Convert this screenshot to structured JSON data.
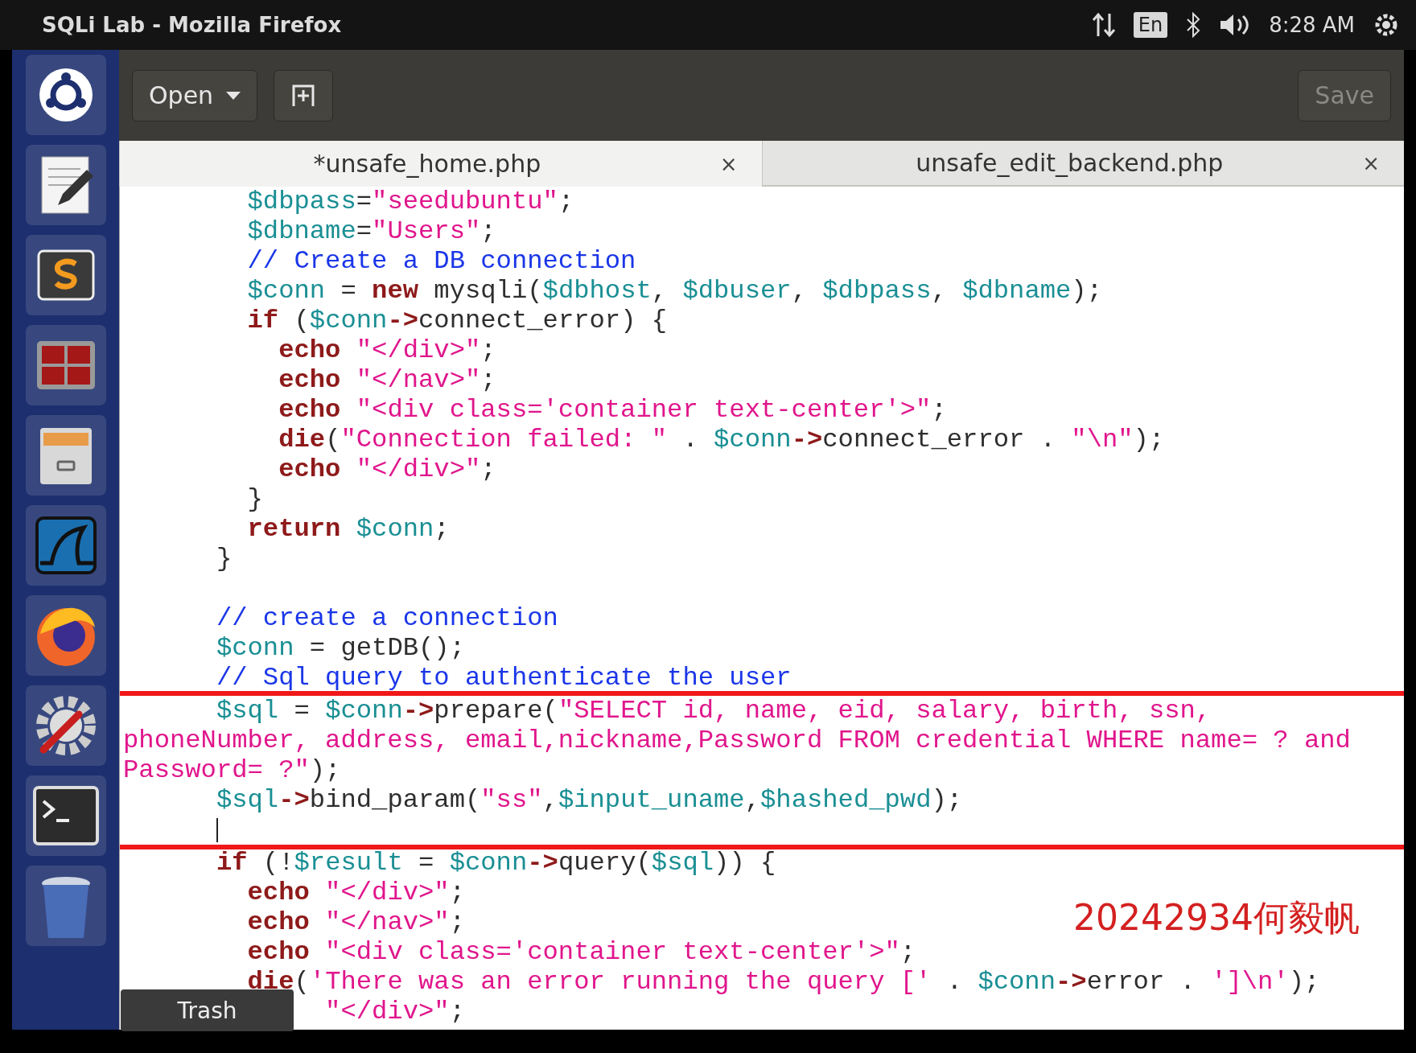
{
  "window": {
    "title": "SQLi Lab - Mozilla Firefox"
  },
  "panel": {
    "keyboard": "En",
    "clock": "8:28 AM"
  },
  "launcher": {
    "items": [
      {
        "kind": "ubuntu"
      },
      {
        "kind": "editor"
      },
      {
        "kind": "sublime"
      },
      {
        "kind": "terminals"
      },
      {
        "kind": "files"
      },
      {
        "kind": "wireshark"
      },
      {
        "kind": "firefox"
      },
      {
        "kind": "settings"
      },
      {
        "kind": "terminal"
      },
      {
        "kind": "trash"
      }
    ],
    "tooltip": "Trash"
  },
  "toolbar": {
    "open": "Open",
    "save": {
      "label": "Save",
      "disabled": true
    }
  },
  "tabs": [
    {
      "label": "*unsafe_home.php",
      "selected": true,
      "close": "×"
    },
    {
      "label": "unsafe_edit_backend.php",
      "selected": false,
      "close": "×"
    }
  ],
  "code_lines": [
    {
      "highlighted": false,
      "tokens": [
        {
          "kind": "var",
          "text": "        $dbpass"
        },
        {
          "kind": "pl",
          "text": "="
        },
        {
          "kind": "str",
          "text": "\"seedubuntu\""
        },
        {
          "kind": "pl",
          "text": ";"
        }
      ]
    },
    {
      "highlighted": false,
      "tokens": [
        {
          "kind": "var",
          "text": "        $dbname"
        },
        {
          "kind": "pl",
          "text": "="
        },
        {
          "kind": "str",
          "text": "\"Users\""
        },
        {
          "kind": "pl",
          "text": ";"
        }
      ]
    },
    {
      "highlighted": false,
      "tokens": [
        {
          "kind": "cmt",
          "text": "        // Create a DB connection"
        }
      ]
    },
    {
      "highlighted": false,
      "tokens": [
        {
          "kind": "var",
          "text": "        $conn"
        },
        {
          "kind": "pl",
          "text": " = "
        },
        {
          "kind": "kw",
          "text": "new"
        },
        {
          "kind": "pl",
          "text": " mysqli("
        },
        {
          "kind": "var",
          "text": "$dbhost"
        },
        {
          "kind": "pl",
          "text": ", "
        },
        {
          "kind": "var",
          "text": "$dbuser"
        },
        {
          "kind": "pl",
          "text": ", "
        },
        {
          "kind": "var",
          "text": "$dbpass"
        },
        {
          "kind": "pl",
          "text": ", "
        },
        {
          "kind": "var",
          "text": "$dbname"
        },
        {
          "kind": "pl",
          "text": ");"
        }
      ]
    },
    {
      "highlighted": false,
      "tokens": [
        {
          "kind": "kw",
          "text": "        if"
        },
        {
          "kind": "pl",
          "text": " ("
        },
        {
          "kind": "var",
          "text": "$conn"
        },
        {
          "kind": "op",
          "text": "->"
        },
        {
          "kind": "pl",
          "text": "connect_error) {"
        }
      ]
    },
    {
      "highlighted": false,
      "tokens": [
        {
          "kind": "kw",
          "text": "          echo"
        },
        {
          "kind": "str",
          "text": " \"</div>\""
        },
        {
          "kind": "pl",
          "text": ";"
        }
      ]
    },
    {
      "highlighted": false,
      "tokens": [
        {
          "kind": "kw",
          "text": "          echo"
        },
        {
          "kind": "str",
          "text": " \"</nav>\""
        },
        {
          "kind": "pl",
          "text": ";"
        }
      ]
    },
    {
      "highlighted": false,
      "tokens": [
        {
          "kind": "kw",
          "text": "          echo"
        },
        {
          "kind": "str",
          "text": " \"<div class='container text-center'>\""
        },
        {
          "kind": "pl",
          "text": ";"
        }
      ]
    },
    {
      "highlighted": false,
      "tokens": [
        {
          "kind": "kw",
          "text": "          die"
        },
        {
          "kind": "pl",
          "text": "("
        },
        {
          "kind": "str",
          "text": "\"Connection failed: \""
        },
        {
          "kind": "pl",
          "text": " . "
        },
        {
          "kind": "var",
          "text": "$conn"
        },
        {
          "kind": "op",
          "text": "->"
        },
        {
          "kind": "pl",
          "text": "connect_error . "
        },
        {
          "kind": "str",
          "text": "\"\\n\""
        },
        {
          "kind": "pl",
          "text": ");"
        }
      ]
    },
    {
      "highlighted": false,
      "tokens": [
        {
          "kind": "kw",
          "text": "          echo"
        },
        {
          "kind": "str",
          "text": " \"</div>\""
        },
        {
          "kind": "pl",
          "text": ";"
        }
      ]
    },
    {
      "highlighted": false,
      "tokens": [
        {
          "kind": "pl",
          "text": "        }"
        }
      ]
    },
    {
      "highlighted": false,
      "tokens": [
        {
          "kind": "kw",
          "text": "        return"
        },
        {
          "kind": "var",
          "text": " $conn"
        },
        {
          "kind": "pl",
          "text": ";"
        }
      ]
    },
    {
      "highlighted": false,
      "tokens": [
        {
          "kind": "pl",
          "text": "      }"
        }
      ]
    },
    {
      "highlighted": false
    },
    {
      "highlighted": false,
      "tokens": [
        {
          "kind": "cmt",
          "text": "      // create a connection"
        }
      ]
    },
    {
      "highlighted": false,
      "tokens": [
        {
          "kind": "var",
          "text": "      $conn"
        },
        {
          "kind": "pl",
          "text": " = getDB();"
        }
      ]
    },
    {
      "highlighted": false,
      "tokens": [
        {
          "kind": "cmt",
          "text": "      // Sql query to authenticate the user"
        }
      ]
    },
    {
      "highlighted": true,
      "tokens": [
        {
          "kind": "var",
          "text": "      $sql"
        },
        {
          "kind": "pl",
          "text": " = "
        },
        {
          "kind": "var",
          "text": "$conn"
        },
        {
          "kind": "op",
          "text": "->"
        },
        {
          "kind": "pl",
          "text": "prepare("
        },
        {
          "kind": "str",
          "text": "\"SELECT id, name, eid, salary, birth, ssn,"
        }
      ]
    },
    {
      "highlighted": true,
      "tokens": [
        {
          "kind": "str",
          "text": "phoneNumber, address, email,nickname,Password FROM credential WHERE name= ? and"
        }
      ]
    },
    {
      "highlighted": true,
      "tokens": [
        {
          "kind": "str",
          "text": "Password= ?\""
        },
        {
          "kind": "pl",
          "text": ");"
        }
      ]
    },
    {
      "highlighted": true,
      "tokens": [
        {
          "kind": "var",
          "text": "      $sql"
        },
        {
          "kind": "op",
          "text": "->"
        },
        {
          "kind": "pl",
          "text": "bind_param("
        },
        {
          "kind": "str",
          "text": "\"ss\""
        },
        {
          "kind": "pl",
          "text": ","
        },
        {
          "kind": "var",
          "text": "$input_uname"
        },
        {
          "kind": "pl",
          "text": ","
        },
        {
          "kind": "var",
          "text": "$hashed_pwd"
        },
        {
          "kind": "pl",
          "text": ");"
        }
      ]
    },
    {
      "highlighted": true,
      "cursor": true
    },
    {
      "highlighted": false,
      "tokens": [
        {
          "kind": "kw",
          "text": "      if"
        },
        {
          "kind": "pl",
          "text": " (!"
        },
        {
          "kind": "var",
          "text": "$result"
        },
        {
          "kind": "pl",
          "text": " = "
        },
        {
          "kind": "var",
          "text": "$conn"
        },
        {
          "kind": "op",
          "text": "->"
        },
        {
          "kind": "pl",
          "text": "query("
        },
        {
          "kind": "var",
          "text": "$sql"
        },
        {
          "kind": "pl",
          "text": ")) {"
        }
      ]
    },
    {
      "highlighted": false,
      "tokens": [
        {
          "kind": "kw",
          "text": "        echo"
        },
        {
          "kind": "str",
          "text": " \"</div>\""
        },
        {
          "kind": "pl",
          "text": ";"
        }
      ]
    },
    {
      "highlighted": false,
      "tokens": [
        {
          "kind": "kw",
          "text": "        echo"
        },
        {
          "kind": "str",
          "text": " \"</nav>\""
        },
        {
          "kind": "pl",
          "text": ";"
        }
      ]
    },
    {
      "highlighted": false,
      "tokens": [
        {
          "kind": "kw",
          "text": "        echo"
        },
        {
          "kind": "str",
          "text": " \"<div class='container text-center'>\""
        },
        {
          "kind": "pl",
          "text": ";"
        }
      ]
    },
    {
      "highlighted": false,
      "tokens": [
        {
          "kind": "kw",
          "text": "        die"
        },
        {
          "kind": "pl",
          "text": "("
        },
        {
          "kind": "str",
          "text": "'There was an error running the query ['"
        },
        {
          "kind": "pl",
          "text": " . "
        },
        {
          "kind": "var",
          "text": "$conn"
        },
        {
          "kind": "op",
          "text": "->"
        },
        {
          "kind": "pl",
          "text": "error . "
        },
        {
          "kind": "str",
          "text": "']\\n'"
        },
        {
          "kind": "pl",
          "text": ");"
        }
      ]
    },
    {
      "highlighted": false,
      "tokens": [
        {
          "kind": "str",
          "text": "             \"</div>\""
        },
        {
          "kind": "pl",
          "text": ";"
        }
      ]
    }
  ],
  "annotation": "20242934何毅帆"
}
